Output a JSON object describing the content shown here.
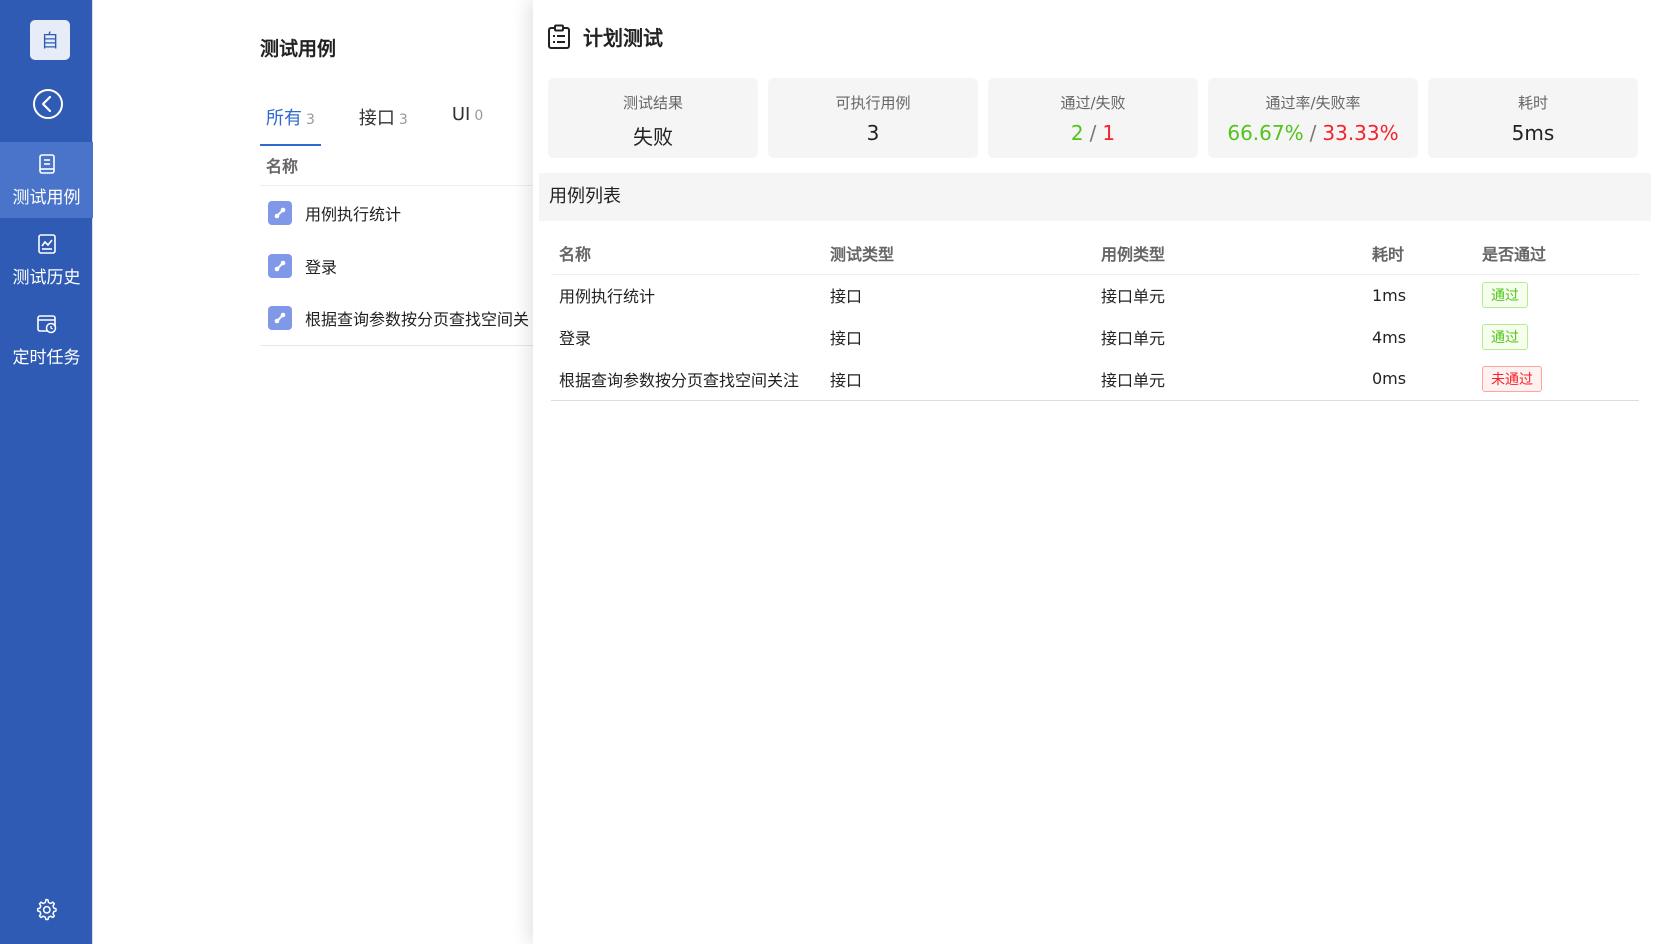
{
  "sidebar": {
    "app_badge": "自",
    "items": [
      {
        "label": "测试用例",
        "icon": "book-icon",
        "active": true
      },
      {
        "label": "测试历史",
        "icon": "chart-icon",
        "active": false
      },
      {
        "label": "定时任务",
        "icon": "schedule-icon",
        "active": false
      }
    ],
    "settings_icon": "gear-icon",
    "colors": {
      "background": "#2f5bb5",
      "active": "#4a74c9"
    }
  },
  "list": {
    "title": "测试用例",
    "tabs": [
      {
        "label": "所有",
        "count": "3",
        "active": true
      },
      {
        "label": "接口",
        "count": "3",
        "active": false
      },
      {
        "label": "UI",
        "count": "0",
        "active": false
      }
    ],
    "column_name": "名称",
    "cases": [
      {
        "name": "用例执行统计"
      },
      {
        "name": "登录"
      },
      {
        "name": "根据查询参数按分页查找空间关"
      }
    ]
  },
  "drawer": {
    "title": "计划测试",
    "stats": {
      "result": {
        "label": "测试结果",
        "value": "失败"
      },
      "executable": {
        "label": "可执行用例",
        "value": "3"
      },
      "pass_fail": {
        "label": "通过/失败",
        "pass": "2",
        "sep": "/",
        "fail": "1"
      },
      "rate": {
        "label": "通过率/失败率",
        "pass": "66.67%",
        "sep": "/",
        "fail": "33.33%"
      },
      "duration": {
        "label": "耗时",
        "value": "5ms"
      }
    },
    "section_title": "用例列表",
    "table": {
      "headers": [
        "名称",
        "测试类型",
        "用例类型",
        "耗时",
        "是否通过"
      ],
      "rows": [
        {
          "name": "用例执行统计",
          "test_type": "接口",
          "case_type": "接口单元",
          "duration": "1ms",
          "result": "通过",
          "passed": true
        },
        {
          "name": "登录",
          "test_type": "接口",
          "case_type": "接口单元",
          "duration": "4ms",
          "result": "通过",
          "passed": true
        },
        {
          "name": "根据查询参数按分页查找空间关注",
          "test_type": "接口",
          "case_type": "接口单元",
          "duration": "0ms",
          "result": "未通过",
          "passed": false
        }
      ]
    },
    "colors": {
      "pass": "#52c41a",
      "fail": "#f5222d"
    }
  }
}
